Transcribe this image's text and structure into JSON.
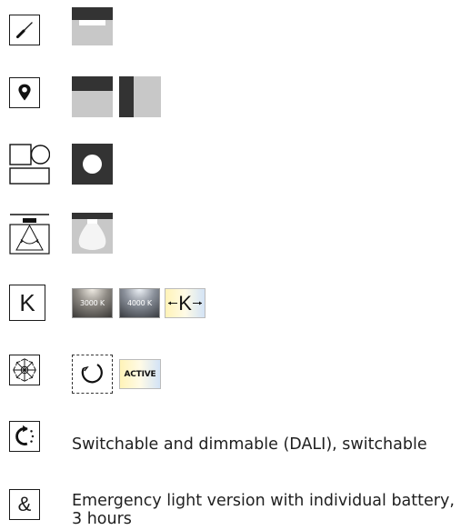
{
  "rows": {
    "mounting": {
      "icon": "screwdriver-icon"
    },
    "installation": {
      "icon": "location-pin-icon"
    },
    "shape": {
      "icon": "shapes-icon"
    },
    "light_distribution": {
      "icon": "beam-angle-icon"
    },
    "color_temperature": {
      "icon_letter": "K",
      "options": [
        "3000 K",
        "4000 K"
      ],
      "tunable_letter": "K"
    },
    "control": {
      "icon": "snowflake-sensor-icon",
      "active_label": "ACTIVE"
    },
    "switching": {
      "icon": "dimmable-refresh-icon",
      "description": "Switchable and dimmable (DALI), switchable"
    },
    "emergency": {
      "icon_symbol": "&",
      "description_line1": "Emergency light version with individual battery,",
      "description_line2": "3 hours"
    }
  },
  "colors": {
    "dark": "#333333",
    "light_gray": "#c8c8c8",
    "warm_white": "#fff6c8",
    "cool_white": "#d8e6f5"
  }
}
